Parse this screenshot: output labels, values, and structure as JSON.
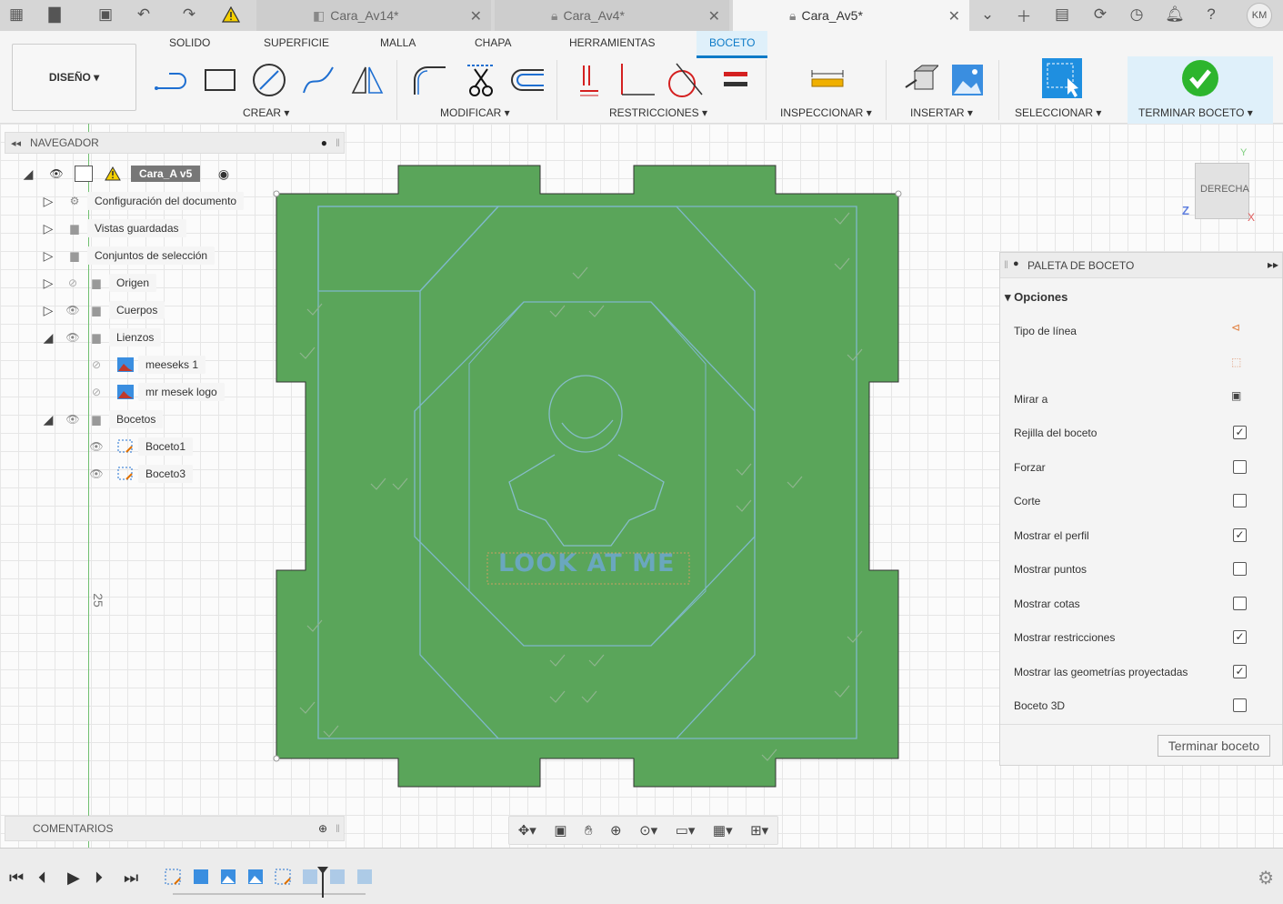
{
  "titlebar": {
    "tabs": [
      {
        "label": "Cara_Av14*",
        "active": false
      },
      {
        "label": "Cara_Av4*",
        "active": false
      },
      {
        "label": "Cara_Av5*",
        "active": true
      }
    ],
    "user_initials": "KM"
  },
  "ribbon": {
    "tabs": [
      "SOLIDO",
      "SUPERFICIE",
      "MALLA",
      "CHAPA",
      "HERRAMIENTAS",
      "BOCETO"
    ],
    "active_tab": "BOCETO",
    "workspace": "DISEÑO",
    "groups": {
      "create": "CREAR",
      "modify": "MODIFICAR",
      "constraints": "RESTRICCIONES",
      "inspect": "INSPECCIONAR",
      "insert": "INSERTAR",
      "select": "SELECCIONAR",
      "finish": "TERMINAR BOCETO"
    }
  },
  "browser": {
    "title": "NAVEGADOR",
    "root": "Cara_A v5",
    "items": [
      {
        "label": "Configuración del documento"
      },
      {
        "label": "Vistas guardadas"
      },
      {
        "label": "Conjuntos de selección"
      },
      {
        "label": "Origen"
      },
      {
        "label": "Cuerpos"
      },
      {
        "label": "Lienzos"
      },
      {
        "label": "meeseks 1"
      },
      {
        "label": "mr mesek logo"
      },
      {
        "label": "Bocetos"
      },
      {
        "label": "Boceto1"
      },
      {
        "label": "Boceto3"
      }
    ]
  },
  "viewcube": {
    "face": "DERECHA",
    "axis_y": "Y",
    "axis_z": "Z",
    "axis_x": "X"
  },
  "canvas": {
    "ruler_value": "25",
    "sketch_text": "LOOK AT ME"
  },
  "palette": {
    "title": "PALETA DE BOCETO",
    "section": "Opciones",
    "options": [
      {
        "label": "Tipo de línea",
        "type": "icon"
      },
      {
        "label": "",
        "type": "icon"
      },
      {
        "label": "Mirar a",
        "type": "icon"
      },
      {
        "label": "Rejilla del boceto",
        "checked": true
      },
      {
        "label": "Forzar",
        "checked": false
      },
      {
        "label": "Corte",
        "checked": false
      },
      {
        "label": "Mostrar el perfil",
        "checked": true
      },
      {
        "label": "Mostrar puntos",
        "checked": false
      },
      {
        "label": "Mostrar cotas",
        "checked": false
      },
      {
        "label": "Mostrar restricciones",
        "checked": true
      },
      {
        "label": "Mostrar las geometrías proyectadas",
        "checked": true
      },
      {
        "label": "Boceto 3D",
        "checked": false
      }
    ],
    "finish_button": "Terminar boceto"
  },
  "comments": {
    "title": "COMENTARIOS"
  },
  "colors": {
    "accent": "#0c7ac7",
    "sketch_fill": "#5aa55a",
    "finish_green": "#2db52d"
  }
}
